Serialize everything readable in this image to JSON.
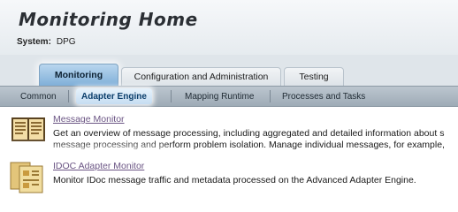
{
  "header": {
    "title": "Monitoring Home",
    "system_label": "System:",
    "system_value": "DPG"
  },
  "tabs": [
    {
      "label": "Monitoring",
      "active": true
    },
    {
      "label": "Configuration and Administration",
      "active": false
    },
    {
      "label": "Testing",
      "active": false
    }
  ],
  "subtabs": [
    {
      "label": "Common",
      "active": false
    },
    {
      "label": "Adapter Engine",
      "active": true
    },
    {
      "label": "Mapping Runtime",
      "active": false
    },
    {
      "label": "Processes and Tasks",
      "active": false
    }
  ],
  "entries": [
    {
      "icon": "message-monitor-icon",
      "link": "Message Monitor",
      "desc_line1": "Get an overview of message processing, including aggregated and detailed information about s",
      "desc_line2": "message processing and perform problem isolation. Manage individual messages, for example,"
    },
    {
      "icon": "idoc-adapter-monitor-icon",
      "link": "IDOC Adapter Monitor",
      "desc_line1": "Monitor IDoc message traffic and metadata processed on the Advanced Adapter Engine."
    }
  ],
  "colors": {
    "active_tab": "#7fafd8",
    "link": "#6b5584",
    "subbar": "#a9b5c0"
  }
}
